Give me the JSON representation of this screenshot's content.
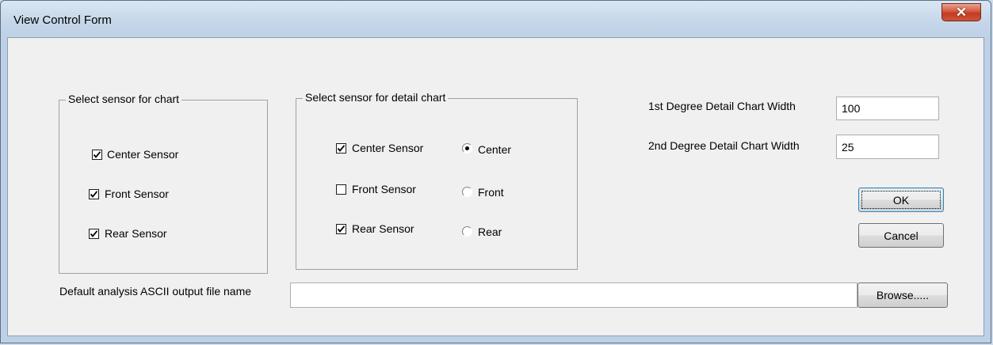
{
  "window": {
    "title": "View Control Form",
    "close_symbol": "✕"
  },
  "chart_group": {
    "title": "Select sensor for chart",
    "items": [
      {
        "label": "Center Sensor",
        "checked": true
      },
      {
        "label": "Front Sensor",
        "checked": true
      },
      {
        "label": "Rear Sensor",
        "checked": true
      }
    ]
  },
  "detail_group": {
    "title": "Select sensor for detail chart",
    "checks": [
      {
        "label": "Center Sensor",
        "checked": true
      },
      {
        "label": "Front Sensor",
        "checked": false
      },
      {
        "label": "Rear Sensor",
        "checked": true
      }
    ],
    "radios": [
      {
        "label": "Center",
        "selected": true
      },
      {
        "label": "Front",
        "selected": false
      },
      {
        "label": "Rear",
        "selected": false
      }
    ]
  },
  "settings": {
    "first_degree_label": "1st Degree Detail Chart Width",
    "first_degree_value": "100",
    "second_degree_label": "2nd Degree Detail Chart Width",
    "second_degree_value": "25"
  },
  "buttons": {
    "ok": "OK",
    "cancel": "Cancel",
    "browse": "Browse....."
  },
  "output": {
    "label": "Default analysis ASCII output file name",
    "value": ""
  }
}
